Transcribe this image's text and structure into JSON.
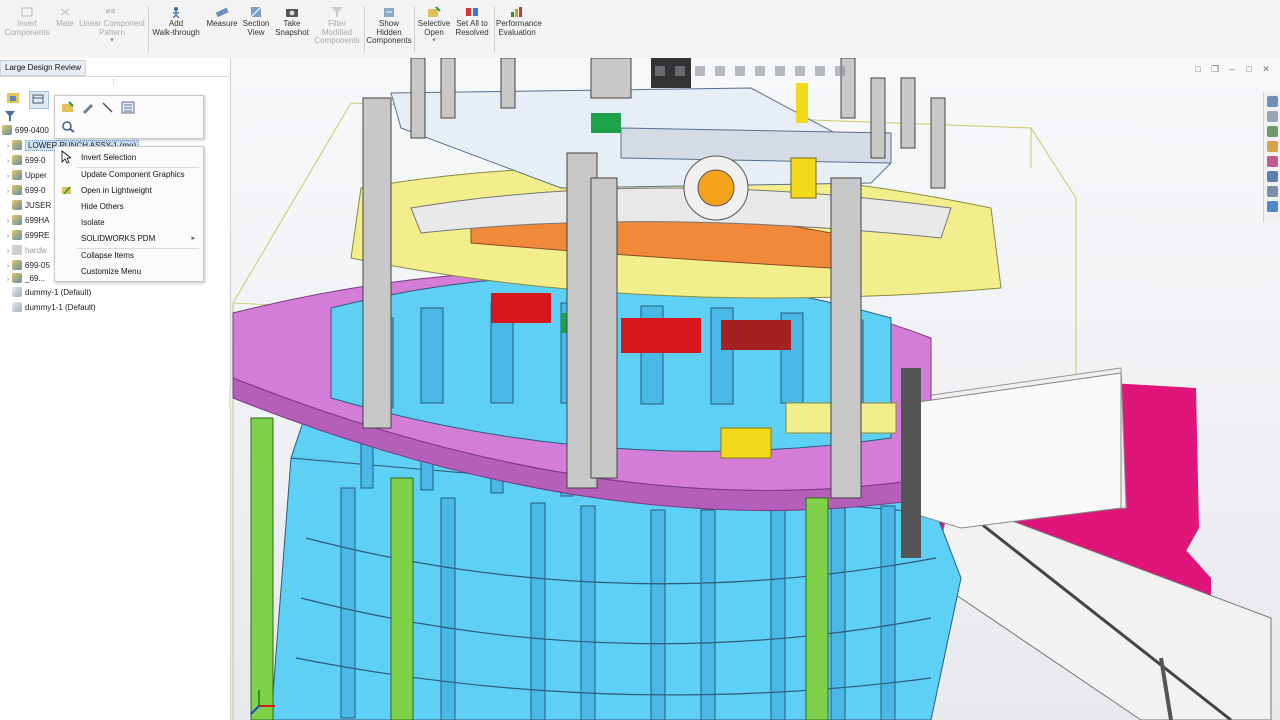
{
  "ribbon": {
    "buttons": [
      {
        "label": "Invert\nComponents",
        "enabled": false,
        "icon": "invert-components-icon"
      },
      {
        "label": "Mate",
        "enabled": false,
        "icon": "mate-icon"
      },
      {
        "label": "Linear Component\nPattern",
        "enabled": false,
        "icon": "linear-pattern-icon"
      },
      {
        "label": "Add\nWalk-through",
        "enabled": true,
        "icon": "walk-through-icon"
      },
      {
        "label": "Measure",
        "enabled": true,
        "icon": "measure-icon"
      },
      {
        "label": "Section\nView",
        "enabled": true,
        "icon": "section-view-icon"
      },
      {
        "label": "Take\nSnapshot",
        "enabled": true,
        "icon": "camera-icon"
      },
      {
        "label": "Filter\nModified\nComponents",
        "enabled": false,
        "icon": "filter-modified-icon"
      },
      {
        "label": "Show\nHidden\nComponents",
        "enabled": true,
        "icon": "show-hidden-icon"
      },
      {
        "label": "Selective\nOpen",
        "enabled": true,
        "icon": "selective-open-icon"
      },
      {
        "label": "Set All to\nResolved",
        "enabled": true,
        "icon": "set-resolved-icon"
      },
      {
        "label": "Performance\nEvaluation",
        "enabled": true,
        "icon": "performance-icon"
      }
    ]
  },
  "panel": {
    "tab_label": "Large Design Review",
    "root": "699-0400",
    "tree": [
      {
        "label": "LOWER PUNCH ASSY-1 (mo)",
        "selected": true,
        "icon": "assembly"
      },
      {
        "label": "699-0",
        "icon": "assembly"
      },
      {
        "label": "Upper",
        "icon": "assembly"
      },
      {
        "label": "699-0",
        "icon": "assembly"
      },
      {
        "label": "JUSER",
        "icon": "assembly"
      },
      {
        "label": "699HA",
        "icon": "assembly"
      },
      {
        "label": "699RE",
        "icon": "assembly"
      },
      {
        "label": "hardw",
        "icon": "folder",
        "muted": true
      },
      {
        "label": "699-05",
        "icon": "assembly"
      },
      {
        "label": "_69...",
        "icon": "assembly"
      },
      {
        "label": "dummy-1 (Default)",
        "icon": "part"
      },
      {
        "label": "dummy1-1 (Default)",
        "icon": "part"
      }
    ]
  },
  "context_menu": {
    "items": [
      {
        "label": "Invert Selection"
      },
      {
        "label": "Update Component Graphics"
      },
      {
        "label": "Open in Lightweight"
      },
      {
        "label": "Hide Others"
      },
      {
        "label": "Isolate"
      },
      {
        "label": "SOLIDWORKS PDM",
        "submenu": true
      },
      {
        "label": "Collapse Items"
      },
      {
        "label": "Customize Menu"
      }
    ]
  },
  "colors": {
    "ribbon_bg": "#f3f3f3",
    "selection": "#cfe3f7",
    "model_blue": "#5ecff5",
    "model_purple": "#d37cd8",
    "model_yellow": "#f3ee8c",
    "model_magenta": "#e8157f",
    "model_green": "#7fd14a",
    "model_gray": "#c8c8c8"
  }
}
